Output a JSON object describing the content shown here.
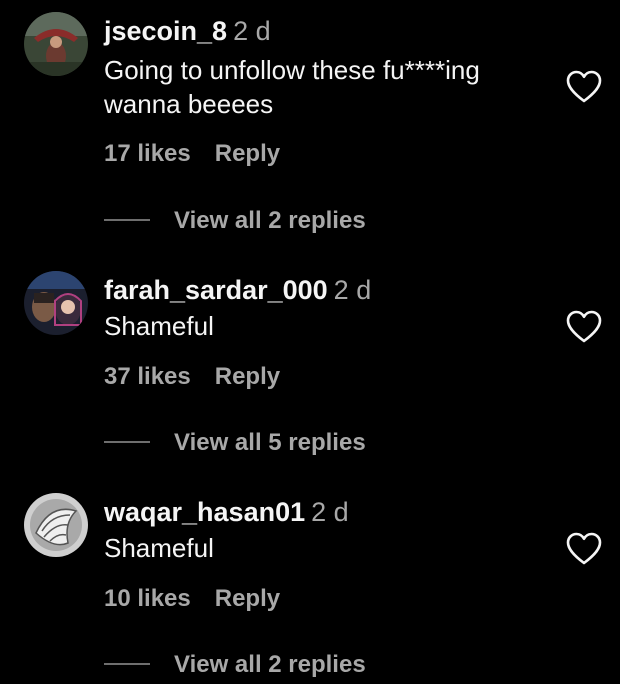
{
  "comments": [
    {
      "username": "jsecoin_8",
      "time": "2 d",
      "text": "Going to unfollow these fu****ing wanna beeees",
      "likes": "17 likes",
      "reply_label": "Reply",
      "view_replies": "View all 2 replies",
      "like_icon": "heart-outline-icon"
    },
    {
      "username": "farah_sardar_000",
      "time": "2 d",
      "text": "Shameful",
      "likes": "37 likes",
      "reply_label": "Reply",
      "view_replies": "View all 5 replies",
      "like_icon": "heart-outline-icon"
    },
    {
      "username": "waqar_hasan01",
      "time": "2 d",
      "text": "Shameful",
      "likes": "10 likes",
      "reply_label": "Reply",
      "view_replies": "View all 2 replies",
      "like_icon": "heart-outline-icon"
    }
  ],
  "colors": {
    "background": "#000000",
    "primary_text": "#f5f5f5",
    "secondary_text": "#a8a8a8"
  }
}
